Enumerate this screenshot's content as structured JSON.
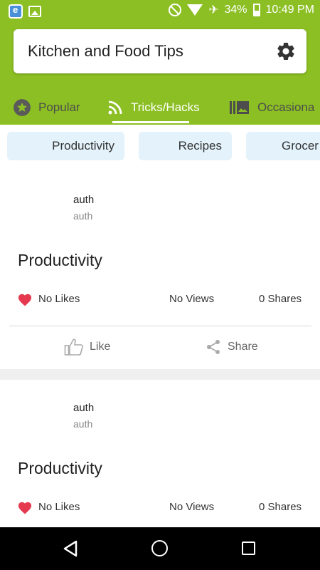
{
  "status_bar": {
    "battery": "34%",
    "time": "10:49 PM"
  },
  "header": {
    "title": "Kitchen and Food Tips"
  },
  "tabs": [
    {
      "label": "Popular",
      "icon": "star-icon"
    },
    {
      "label": "Tricks/Hacks",
      "icon": "rss-icon"
    },
    {
      "label": "Occasiona",
      "icon": "gallery-icon"
    }
  ],
  "active_tab": "Tricks/Hacks",
  "chips": [
    {
      "label": "Productivity"
    },
    {
      "label": "Recipes"
    },
    {
      "label": "Grocer"
    }
  ],
  "posts": [
    {
      "author": "auth",
      "author_sub": "auth",
      "title": "Productivity",
      "likes": "No Likes",
      "views": "No Views",
      "shares": "0 Shares",
      "like_label": "Like",
      "share_label": "Share"
    },
    {
      "author": "auth",
      "author_sub": "auth",
      "title": "Productivity",
      "likes": "No Likes",
      "views": "No Views",
      "shares": "0 Shares"
    }
  ],
  "colors": {
    "brand_green": "#8cbf24",
    "chip_bg": "#e3f2fb",
    "heart_red": "#e53950"
  }
}
